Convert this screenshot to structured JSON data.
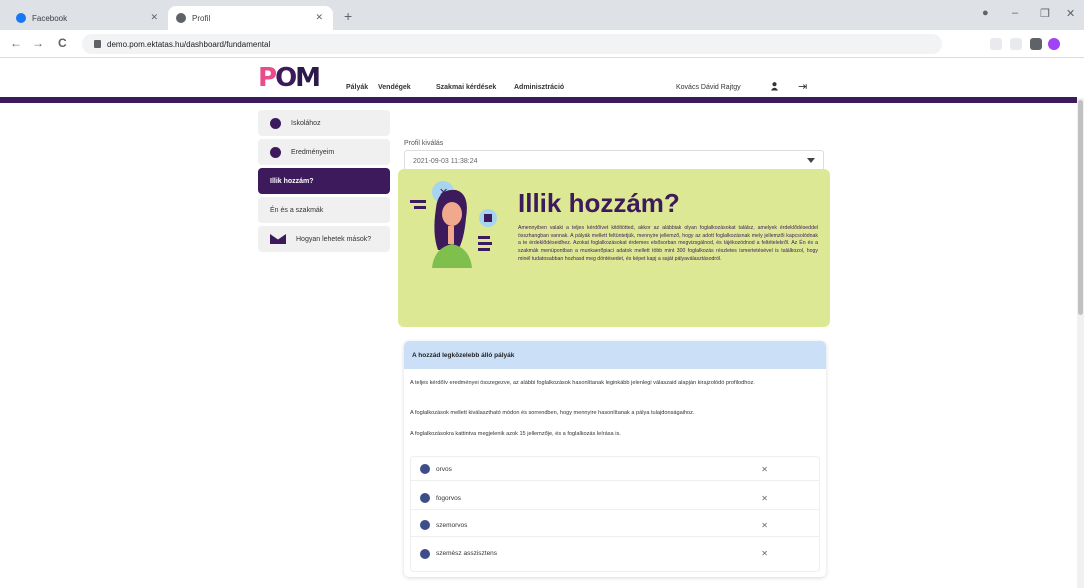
{
  "browser": {
    "tabs": [
      {
        "title": "Facebook",
        "active": false
      },
      {
        "title": "Profil",
        "active": true
      }
    ],
    "new_tab": "+",
    "window_controls": {
      "minimize": "–",
      "restore": "❐",
      "close": "✕"
    },
    "nav": {
      "back": "←",
      "forward": "→",
      "reload": "C"
    },
    "url": "demo.pom.ektatas.hu/dashboard/fundamental"
  },
  "app": {
    "logo": {
      "p": "P",
      "o": "O",
      "m": "M"
    },
    "nav": [
      "Pályák",
      "Vendégek",
      "Szakmai kérdések",
      "Adminisztráció"
    ],
    "user": "Kovács Dávid Rajtgy",
    "logout_icon": "logout-icon"
  },
  "sidebar": {
    "items": [
      {
        "label": "Iskolához",
        "icon": "school-icon",
        "active": false
      },
      {
        "label": "Eredményeim",
        "icon": "user-icon",
        "active": false
      },
      {
        "label": "Illik hozzám?",
        "icon": "card-icon",
        "active": true
      },
      {
        "label": "Én és a szakmák",
        "icon": "card-icon",
        "active": false
      },
      {
        "label": "Hogyan lehetek mások?",
        "icon": "envelope-icon",
        "active": false
      }
    ]
  },
  "main": {
    "profile_label": "Profil kiválás",
    "profile_value": "2021-09-03 11:38:24",
    "hero": {
      "title": "Illik hozzám?",
      "text": "Amennyiben valaki a teljes kérdőívet kitöltötted, akkor az alábbiak olyan foglalkozásokat találsz, amelyek érdeklődéseddel összhangban vannak. A pályák mellett feltüntetjük, mennyire jellemző, hogy az adott foglalkozásnak mely jellemzői kapcsolódnak a te érdeklődéseidhez. Azokat foglalkozásokat érdemes elsősorban megvizsgálnod, és tájékozódnod a feltételekről. Az Én és a szakmák menüpontban a munkaerőpiaci adatok mellett több mint 300 foglalkozás részletes ismertetésével is találkozol, hogy minél tudatosabban hozhasd meg döntésedet, és képet kapj a saját pályaválasztásodról."
    },
    "card": {
      "title": "A hozzád legközelebb álló pályák",
      "para1": "A teljes kérdőív eredményei összegezve, az alábbi foglalkozások hasonlítanak leginkább jelenlegi válaszaid alapján kirajzolódó profilodhoz.",
      "para2": "A foglalkozások mellett kiválasztható módon és sorrendben, hogy mennyire hasonlítanak a pálya tulajdonságaihoz.",
      "para3": "A foglalkozásokra kattintva megjelenik azok 15 jellemzője, és a foglalkozás leírása is.",
      "items": [
        "orvos",
        "fogorvos",
        "szemorvos",
        "szemész asszisztens"
      ],
      "delete_glyph": "✕"
    }
  },
  "colors": {
    "brand_purple": "#3d1a5b",
    "hero_green": "#dde894",
    "card_header_blue": "#cbe0f7",
    "logo_pink": "#e94c89"
  }
}
